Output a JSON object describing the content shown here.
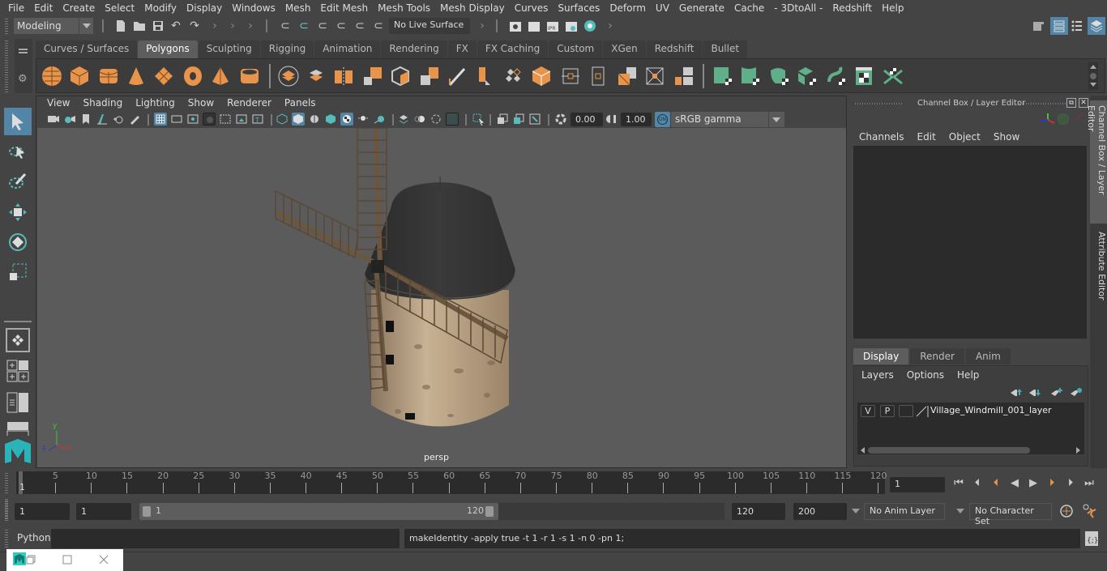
{
  "menubar": [
    "File",
    "Edit",
    "Create",
    "Select",
    "Modify",
    "Display",
    "Windows",
    "Mesh",
    "Edit Mesh",
    "Mesh Tools",
    "Mesh Display",
    "Curves",
    "Surfaces",
    "Deform",
    "UV",
    "Generate",
    "Cache",
    "- 3DtoAll -",
    "Redshift",
    "Help"
  ],
  "statusline": {
    "workspace": "Modeling",
    "live_surface": "No Live Surface"
  },
  "shelf": {
    "tabs": [
      "Curves / Surfaces",
      "Polygons",
      "Sculpting",
      "Rigging",
      "Animation",
      "Rendering",
      "FX",
      "FX Caching",
      "Custom",
      "XGen",
      "Redshift",
      "Bullet"
    ],
    "active_tab": "Polygons",
    "icons": [
      "poly-sphere-icon",
      "poly-cube-icon",
      "poly-cylinder-icon",
      "poly-cone-icon",
      "poly-plane-icon",
      "poly-torus-icon",
      "poly-pyramid-icon",
      "poly-pipe-icon",
      "combine-icon",
      "separate-icon",
      "mirror-icon",
      "smooth-icon",
      "extrude-icon",
      "bridge-icon",
      "append-icon",
      "multicut-icon",
      "target-weld-icon",
      "bevel-icon",
      "insert-edge-loop-icon",
      "edge-loop-icon",
      "fill-hole-icon",
      "poke-icon",
      "extract-icon",
      "planar-uv-icon",
      "cylindrical-uv-icon",
      "spherical-uv-icon",
      "automatic-uv-icon",
      "unfold-uv-icon",
      "uv-editor-icon",
      "layout-uv-icon"
    ]
  },
  "viewport": {
    "menu": [
      "View",
      "Shading",
      "Lighting",
      "Show",
      "Renderer",
      "Panels"
    ],
    "exposure": "0.00",
    "gamma": "1.00",
    "color_mgmt_toggle": "ON",
    "color_space": "sRGB gamma",
    "camera_label": "persp",
    "axis": {
      "x": "x",
      "y": "y",
      "z": "z"
    }
  },
  "channel_box": {
    "title": "Channel Box / Layer Editor",
    "menu": [
      "Channels",
      "Edit",
      "Object",
      "Show"
    ]
  },
  "layer_editor": {
    "tabs": [
      "Display",
      "Render",
      "Anim"
    ],
    "active_tab": "Display",
    "menu": [
      "Layers",
      "Options",
      "Help"
    ],
    "layers": [
      {
        "visible": "V",
        "playback": "P",
        "name": "Village_Windmill_001_layer"
      }
    ]
  },
  "side_tabs": [
    "Channel Box / Layer Editor",
    "Attribute Editor"
  ],
  "timeline": {
    "ticks": [
      5,
      10,
      15,
      20,
      25,
      30,
      35,
      40,
      45,
      50,
      55,
      60,
      65,
      70,
      75,
      80,
      85,
      90,
      95,
      100,
      105,
      110,
      115,
      120
    ],
    "start": 1,
    "end": 120,
    "current_frame_label": "1",
    "current_frame_field": "1"
  },
  "range": {
    "start_field": "1",
    "playback_start": "1",
    "slider_start": "1",
    "slider_end": "120",
    "playback_end": "120",
    "anim_end": "200",
    "anim_layer": "No Anim Layer",
    "character_set": "No Character Set"
  },
  "command_line": {
    "language": "Python",
    "input": "",
    "output": "makeIdentity -apply true -t 1 -r 1 -s 1 -n 0 -pn 1;"
  },
  "colors": {
    "accent": "#5285a6",
    "shelf_poly": "#e8944a",
    "shelf_uv": "#5fb08a",
    "bg": "#444444"
  }
}
